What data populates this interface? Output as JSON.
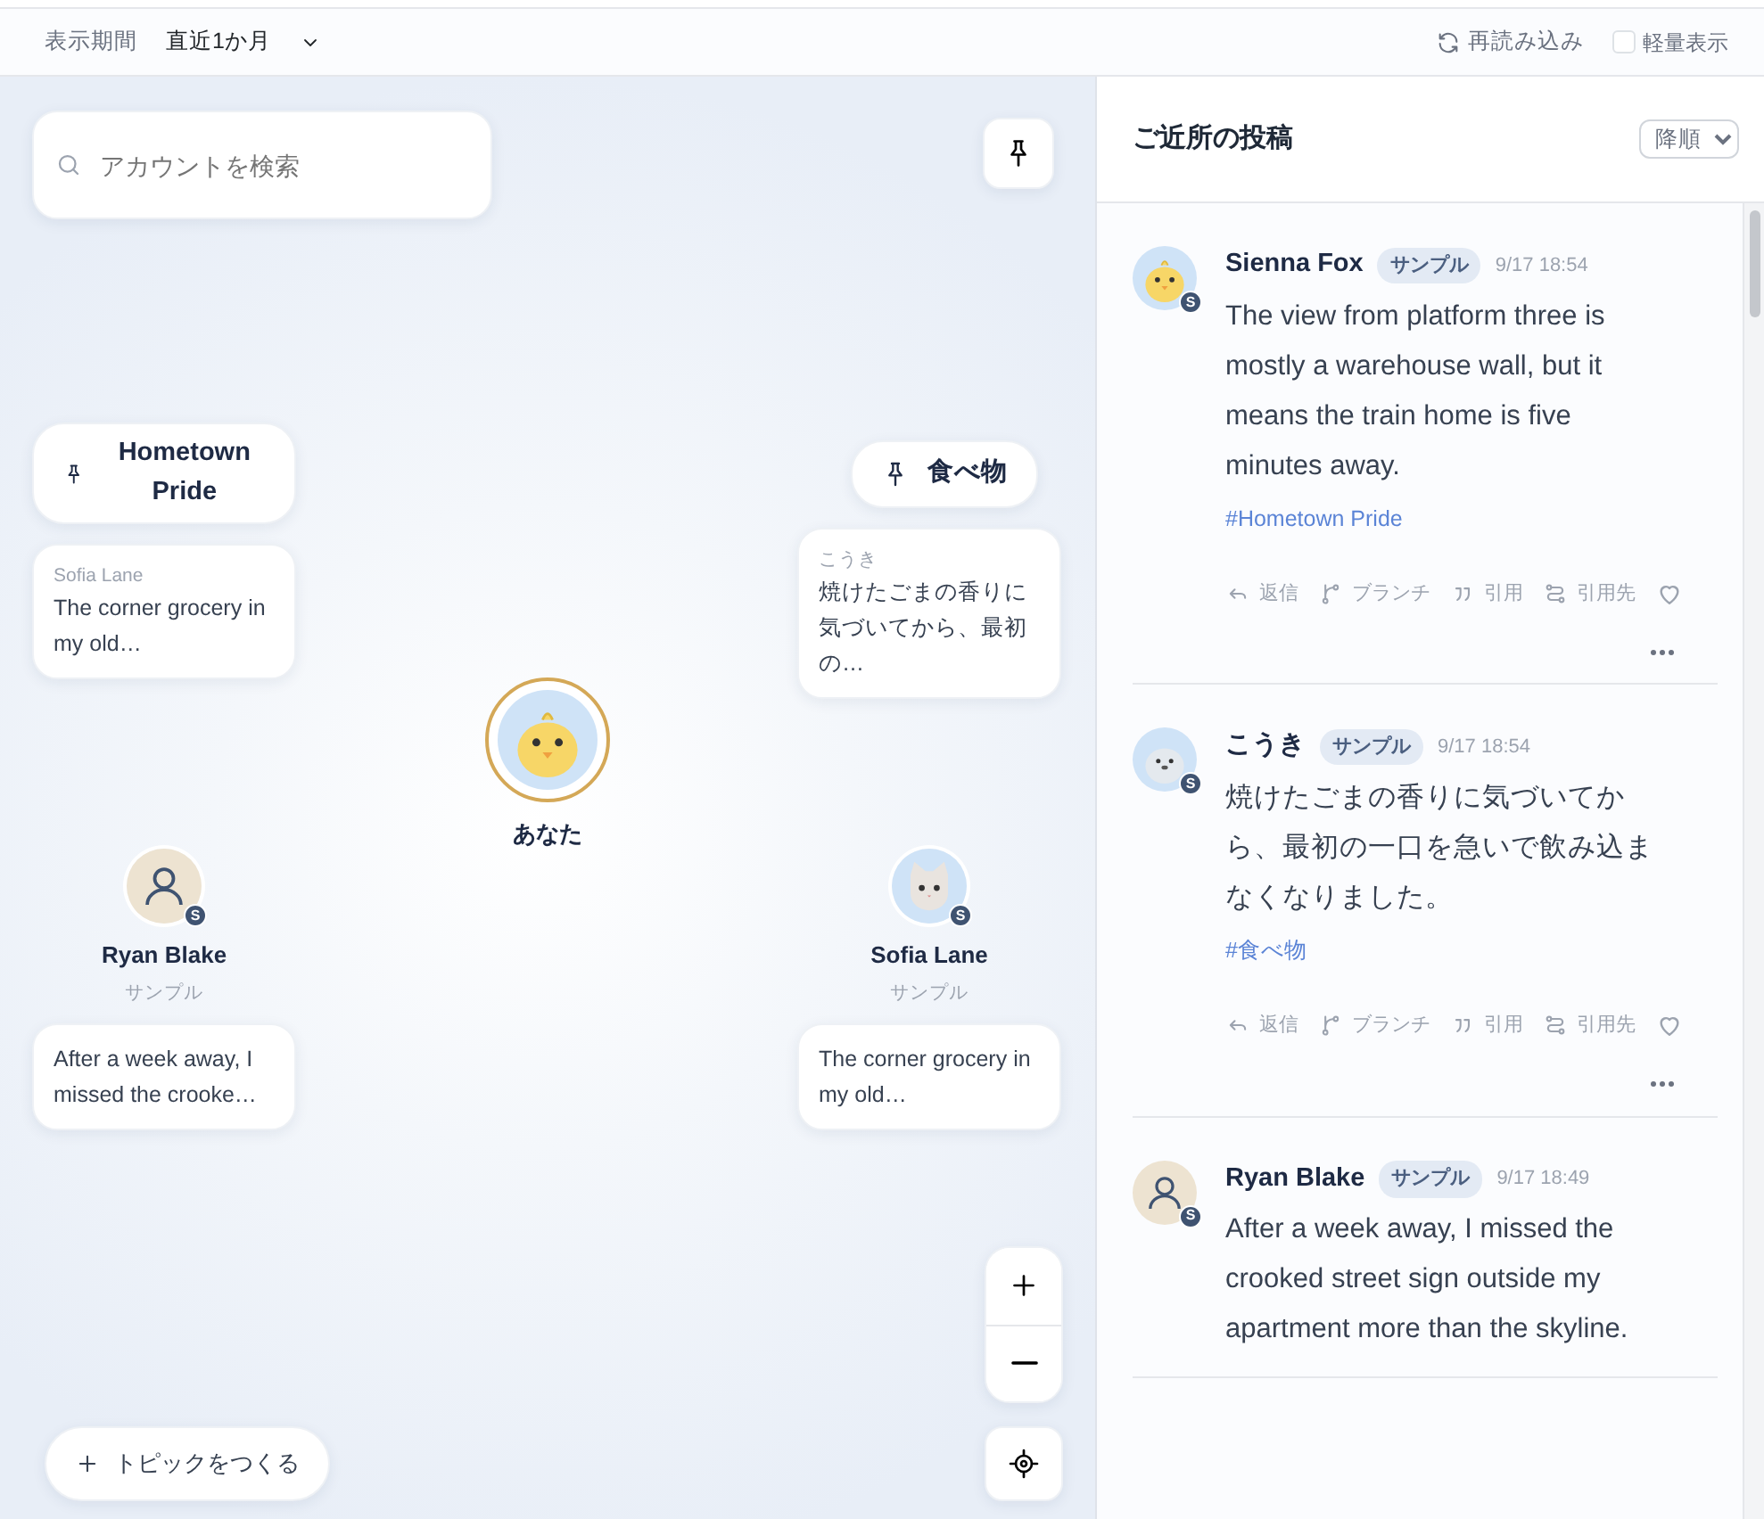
{
  "toolbar": {
    "period_label": "表示期間",
    "period_value": "直近1か月",
    "reload": "再読み込み",
    "light_mode": {
      "label": "軽量表示",
      "checked": false
    }
  },
  "map": {
    "search_placeholder": "アカウントを検索",
    "topics": [
      {
        "label": "Hometown Pride",
        "preview": {
          "author": "Sofia Lane",
          "text": "The corner grocery in my old…"
        }
      },
      {
        "label": "食べ物",
        "preview": {
          "author": "こうき",
          "text": "焼けたごまの香りに気づいてから、最初の…"
        }
      }
    ],
    "me": {
      "label": "あなた",
      "kind": "chick"
    },
    "users": [
      {
        "name": "Ryan Blake",
        "tag": "サンプル",
        "kind": "person",
        "badge": "S",
        "preview": "After a week away, I missed the crooke…"
      },
      {
        "name": "Sofia Lane",
        "tag": "サンプル",
        "kind": "cat",
        "badge": "S",
        "preview": "The corner grocery in my old…"
      }
    ],
    "create_button": "トピックをつくる"
  },
  "feed": {
    "title": "ご近所の投稿",
    "sort": "降順",
    "posts": [
      {
        "name": "Sienna Fox",
        "tag": "サンプル",
        "time": "9/17 18:54",
        "kind": "chick",
        "badge": "S",
        "body": "The view from platform three is mostly a warehouse wall, but it means the train home is five minutes away.",
        "hashtag": "#Hometown Pride",
        "actions": [
          "返信",
          "ブランチ",
          "引用",
          "引用先"
        ],
        "liked": false
      },
      {
        "name": "こうき",
        "tag": "サンプル",
        "time": "9/17 18:54",
        "kind": "seal",
        "badge": "S",
        "body": "焼けたごまの香りに気づいてから、最初の一口を急いで飲み込まなくなりました。",
        "hashtag": "#食べ物",
        "actions": [
          "返信",
          "ブランチ",
          "引用",
          "引用先"
        ],
        "liked": false
      },
      {
        "name": "Ryan Blake",
        "tag": "サンプル",
        "time": "9/17 18:49",
        "kind": "person",
        "badge": "S",
        "body": "After a week away, I missed the crooked street sign outside my apartment more than the skyline."
      }
    ]
  }
}
